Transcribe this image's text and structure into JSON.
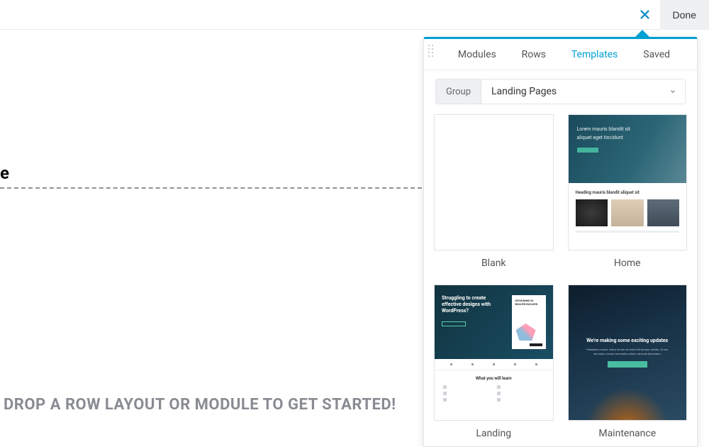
{
  "topbar": {
    "done_label": "Done"
  },
  "canvas": {
    "fragment_text": "e",
    "drop_cta": "DROP A ROW LAYOUT OR MODULE TO GET STARTED!"
  },
  "panel": {
    "tabs": [
      {
        "id": "modules",
        "label": "Modules",
        "active": false
      },
      {
        "id": "rows",
        "label": "Rows",
        "active": false
      },
      {
        "id": "templates",
        "label": "Templates",
        "active": true
      },
      {
        "id": "saved",
        "label": "Saved",
        "active": false
      }
    ],
    "filter": {
      "group_label": "Group",
      "selected": "Landing Pages"
    },
    "templates": [
      {
        "id": "blank",
        "label": "Blank"
      },
      {
        "id": "home",
        "label": "Home"
      },
      {
        "id": "landing",
        "label": "Landing"
      },
      {
        "id": "maintenance",
        "label": "Maintenance"
      }
    ],
    "thumb_text": {
      "home_hero_line1": "Lorem mauris blandit sit",
      "home_hero_line2": "aliquet eget tincidunt",
      "home_subheading": "Heading mauris blandit aliquet sit",
      "landing_headline": "Struggling to create effective designs with WordPress?",
      "landing_book_title": "DESIGNING IN BEAVER BUILDER",
      "landing_section_title": "What you will learn",
      "maintenance_heading": "We're making some exciting updates",
      "maintenance_sub": "Phasellus cursus. Sed a lectus sit amet elit tempor mattis. Ut nec nisi nulla, cursus venenatis nullam vehicula bibendum."
    }
  }
}
